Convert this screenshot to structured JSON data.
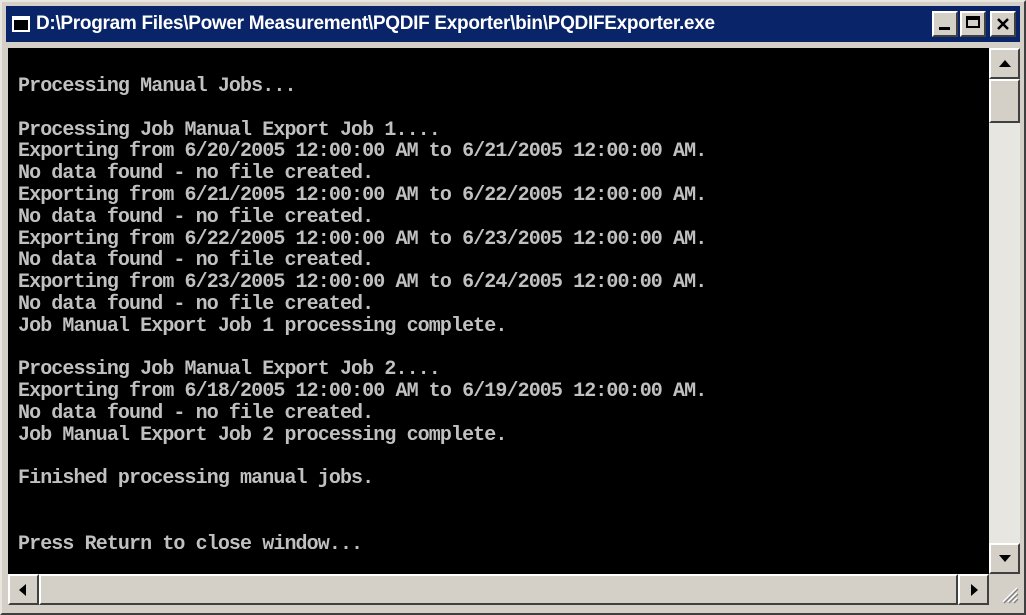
{
  "window": {
    "title": "D:\\Program Files\\Power Measurement\\PQDIF Exporter\\bin\\PQDIFExporter.exe",
    "buttons": {
      "minimize": "minimize-icon",
      "maximize": "maximize-icon",
      "close": "close-icon"
    }
  },
  "console": {
    "background": "#000000",
    "foreground": "#c0c0c0",
    "text": "Processing Manual Jobs...\n\nProcessing Job Manual Export Job 1....\nExporting from 6/20/2005 12:00:00 AM to 6/21/2005 12:00:00 AM.\nNo data found - no file created.\nExporting from 6/21/2005 12:00:00 AM to 6/22/2005 12:00:00 AM.\nNo data found - no file created.\nExporting from 6/22/2005 12:00:00 AM to 6/23/2005 12:00:00 AM.\nNo data found - no file created.\nExporting from 6/23/2005 12:00:00 AM to 6/24/2005 12:00:00 AM.\nNo data found - no file created.\nJob Manual Export Job 1 processing complete.\n\nProcessing Job Manual Export Job 2....\nExporting from 6/18/2005 12:00:00 AM to 6/19/2005 12:00:00 AM.\nNo data found - no file created.\nJob Manual Export Job 2 processing complete.\n\nFinished processing manual jobs.\n\n\nPress Return to close window..."
  },
  "scrollbars": {
    "vertical": {
      "up": "arrow-up-icon",
      "down": "arrow-down-icon"
    },
    "horizontal": {
      "left": "arrow-left-icon",
      "right": "arrow-right-icon"
    }
  }
}
